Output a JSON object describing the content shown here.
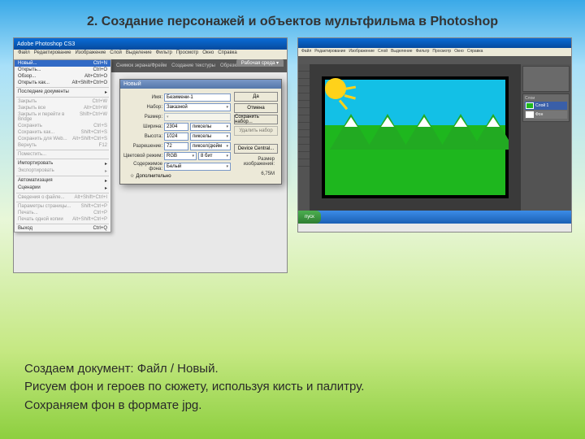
{
  "title": "2. Создание персонажей и объектов мультфильма в Photoshop",
  "ps": {
    "app_title": "Adobe Photoshop CS3",
    "menus": [
      "Файл",
      "Редактирование",
      "Изображение",
      "Слой",
      "Выделение",
      "Фильтр",
      "Просмотр",
      "Окно",
      "Справка"
    ],
    "file_menu": {
      "new": {
        "label": "Новый...",
        "shortcut": "Ctrl+N"
      },
      "open": {
        "label": "Открыть...",
        "shortcut": "Ctrl+O"
      },
      "browse": {
        "label": "Обзор...",
        "shortcut": "Alt+Ctrl+O"
      },
      "open_as": {
        "label": "Открыть как...",
        "shortcut": "Alt+Shift+Ctrl+O"
      },
      "recent": {
        "label": "Последние документы"
      },
      "close": {
        "label": "Закрыть",
        "shortcut": "Ctrl+W"
      },
      "close_all": {
        "label": "Закрыть все",
        "shortcut": "Alt+Ctrl+W"
      },
      "close_bridge": {
        "label": "Закрыть и перейти в Bridge",
        "shortcut": "Shift+Ctrl+W"
      },
      "save": {
        "label": "Сохранить",
        "shortcut": "Ctrl+S"
      },
      "save_as": {
        "label": "Сохранить как...",
        "shortcut": "Shift+Ctrl+S"
      },
      "save_web": {
        "label": "Сохранить для Web...",
        "shortcut": "Alt+Shift+Ctrl+S"
      },
      "revert": {
        "label": "Вернуть",
        "shortcut": "F12"
      },
      "place": {
        "label": "Поместить..."
      },
      "import": {
        "label": "Импортировать"
      },
      "export": {
        "label": "Экспортировать"
      },
      "automate": {
        "label": "Автоматизация"
      },
      "scripts": {
        "label": "Сценарии"
      },
      "file_info": {
        "label": "Сведения о файле...",
        "shortcut": "Alt+Shift+Ctrl+I"
      },
      "page_setup": {
        "label": "Параметры страницы...",
        "shortcut": "Shift+Ctrl+P"
      },
      "print": {
        "label": "Печать...",
        "shortcut": "Ctrl+P"
      },
      "print_one": {
        "label": "Печать одной копии",
        "shortcut": "Alt+Shift+Ctrl+P"
      },
      "exit": {
        "label": "Выход",
        "shortcut": "Ctrl+Q"
      }
    },
    "optbar": {
      "a": "Снимок экрана/Фрейм",
      "b": "Создание текстуры",
      "c": "Обрезка всех слоев"
    },
    "workspace": "Рабочая среда ▾"
  },
  "dialog": {
    "title": "Новый",
    "name_label": "Имя:",
    "name_value": "Безимени-1",
    "preset_label": "Набор:",
    "preset_value": "Заказной",
    "size_label": "Размер:",
    "width_label": "Ширина:",
    "width_value": "2304",
    "width_unit": "пикселы",
    "height_label": "Высота:",
    "height_value": "1024",
    "height_unit": "пикселы",
    "res_label": "Разрешение:",
    "res_value": "72",
    "res_unit": "пиксел/дюйм",
    "mode_label": "Цветовой режим:",
    "mode_value": "RGB",
    "depth_value": "8 бит",
    "bg_label": "Содержимое фона:",
    "bg_value": "Белый",
    "advanced": "Дополнительно",
    "ok": "Да",
    "cancel": "Отмена",
    "save_preset": "Сохранить набор...",
    "delete_preset": "Удалить набор",
    "device": "Device Central...",
    "size_caption": "Размер изображения:",
    "size_value": "6,75М"
  },
  "s2": {
    "menus": [
      "Файл",
      "Редактирование",
      "Изображение",
      "Слой",
      "Выделение",
      "Фильтр",
      "Просмотр",
      "Окно",
      "Справка"
    ],
    "layers_title": "Слои",
    "layer1": "Слой 1",
    "bg_layer": "Фон",
    "start": "пуск"
  },
  "instructions": {
    "l1": "Создаем документ: Файл / Новый.",
    "l2": "Рисуем фон и героев по сюжету, используя кисть и палитру.",
    "l3": "Сохраняем фон в формате jpg."
  }
}
